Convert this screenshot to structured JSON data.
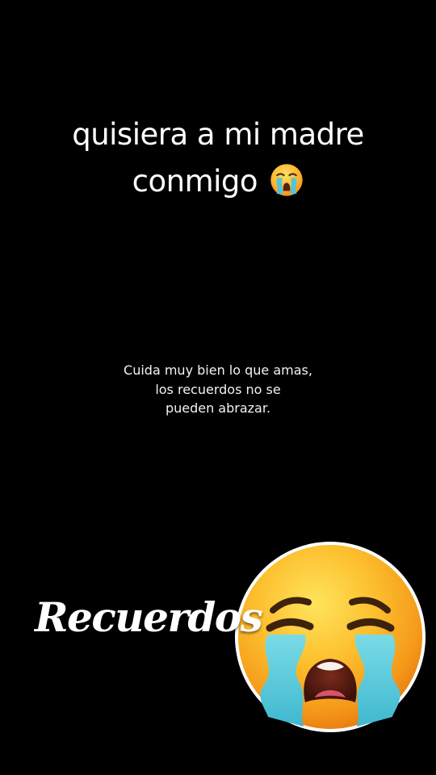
{
  "caption": {
    "line1": "quisiera a mi madre",
    "line2": "conmigo",
    "emoji": "loudly-crying-face-emoji-icon"
  },
  "quote": {
    "line1": "Cuida muy bien lo que amas,",
    "line2": "los recuerdos no se",
    "line3": "pueden abrazar."
  },
  "title": "Recuerdos",
  "sticker": {
    "icon": "loudly-crying-face-emoji-icon"
  },
  "colors": {
    "background": "#000000",
    "text": "#ffffff",
    "emoji_face": "#f9a824",
    "emoji_tears": "#52c6d8"
  }
}
